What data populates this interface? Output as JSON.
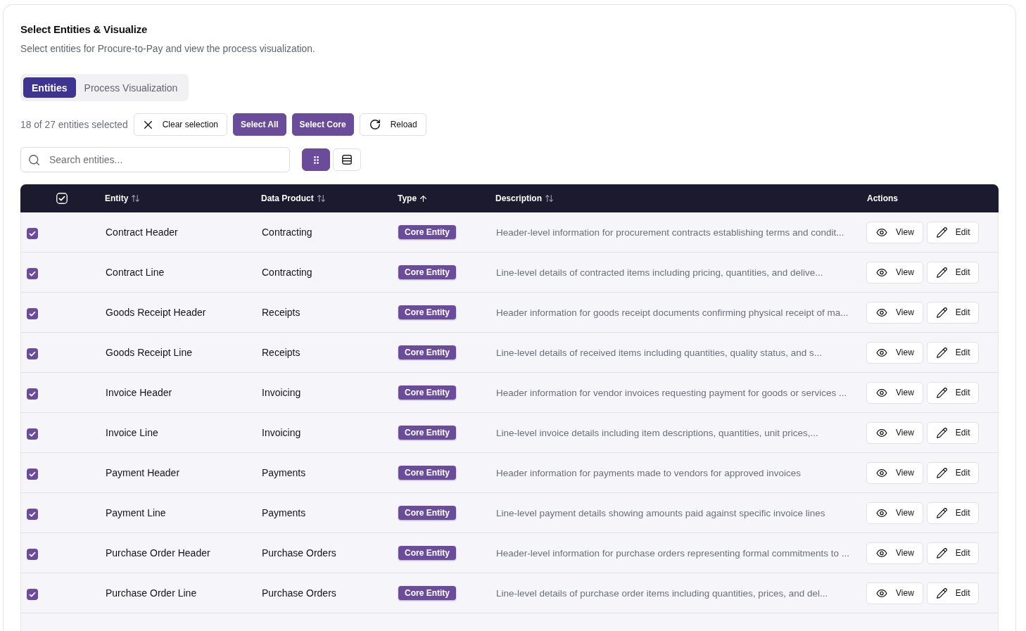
{
  "panel": {
    "title": "Select Entities & Visualize",
    "subtitle": "Select entities for Procure-to-Pay and view the process visualization."
  },
  "tabs": [
    {
      "label": "Entities",
      "selected": true
    },
    {
      "label": "Process Visualization",
      "selected": false
    }
  ],
  "toolbar": {
    "selection_summary": "18 of 27 entities selected",
    "buttons": [
      {
        "label": "Clear selection",
        "kind": "clear"
      },
      {
        "label": "Select All",
        "kind": "primary"
      },
      {
        "label": "Select Core",
        "kind": "primary"
      },
      {
        "label": "Reload",
        "kind": "reload"
      }
    ]
  },
  "search": {
    "placeholder": "Search entities..."
  },
  "view_modes": [
    {
      "kind": "grid",
      "selected": true
    },
    {
      "kind": "list",
      "selected": false
    }
  ],
  "table": {
    "select_all": {
      "checked": true
    },
    "columns": [
      {
        "label": "Entity",
        "sortable": true,
        "sorted": false
      },
      {
        "label": "Data Product",
        "sortable": true,
        "sorted": false
      },
      {
        "label": "Type",
        "sortable": true,
        "sorted": true
      },
      {
        "label": "Description",
        "sortable": true,
        "sorted": false
      },
      {
        "label": "Actions",
        "sortable": false
      }
    ],
    "rows": [
      {
        "selected": true,
        "entity": "Contract Header",
        "data_product": "Contracting",
        "type": "Core Entity",
        "description": "Header-level information for procurement contracts establishing terms and condit...",
        "actions": [
          {
            "label": "View",
            "kind": "view"
          },
          {
            "label": "Edit",
            "kind": "edit"
          }
        ]
      },
      {
        "selected": true,
        "entity": "Contract Line",
        "data_product": "Contracting",
        "type": "Core Entity",
        "description": "Line-level details of contracted items including pricing, quantities, and delive...",
        "actions": [
          {
            "label": "View",
            "kind": "view"
          },
          {
            "label": "Edit",
            "kind": "edit"
          }
        ]
      },
      {
        "selected": true,
        "entity": "Goods Receipt Header",
        "data_product": "Receipts",
        "type": "Core Entity",
        "description": "Header information for goods receipt documents confirming physical receipt of ma...",
        "actions": [
          {
            "label": "View",
            "kind": "view"
          },
          {
            "label": "Edit",
            "kind": "edit"
          }
        ]
      },
      {
        "selected": true,
        "entity": "Goods Receipt Line",
        "data_product": "Receipts",
        "type": "Core Entity",
        "description": "Line-level details of received items including quantities, quality status, and s...",
        "actions": [
          {
            "label": "View",
            "kind": "view"
          },
          {
            "label": "Edit",
            "kind": "edit"
          }
        ]
      },
      {
        "selected": true,
        "entity": "Invoice Header",
        "data_product": "Invoicing",
        "type": "Core Entity",
        "description": "Header information for vendor invoices requesting payment for goods or services ...",
        "actions": [
          {
            "label": "View",
            "kind": "view"
          },
          {
            "label": "Edit",
            "kind": "edit"
          }
        ]
      },
      {
        "selected": true,
        "entity": "Invoice Line",
        "data_product": "Invoicing",
        "type": "Core Entity",
        "description": "Line-level invoice details including item descriptions, quantities, unit prices,...",
        "actions": [
          {
            "label": "View",
            "kind": "view"
          },
          {
            "label": "Edit",
            "kind": "edit"
          }
        ]
      },
      {
        "selected": true,
        "entity": "Payment Header",
        "data_product": "Payments",
        "type": "Core Entity",
        "description": "Header information for payments made to vendors for approved invoices",
        "actions": [
          {
            "label": "View",
            "kind": "view"
          },
          {
            "label": "Edit",
            "kind": "edit"
          }
        ]
      },
      {
        "selected": true,
        "entity": "Payment Line",
        "data_product": "Payments",
        "type": "Core Entity",
        "description": "Line-level payment details showing amounts paid against specific invoice lines",
        "actions": [
          {
            "label": "View",
            "kind": "view"
          },
          {
            "label": "Edit",
            "kind": "edit"
          }
        ]
      },
      {
        "selected": true,
        "entity": "Purchase Order Header",
        "data_product": "Purchase Orders",
        "type": "Core Entity",
        "description": "Header-level information for purchase orders representing formal commitments to ...",
        "actions": [
          {
            "label": "View",
            "kind": "view"
          },
          {
            "label": "Edit",
            "kind": "edit"
          }
        ]
      },
      {
        "selected": true,
        "entity": "Purchase Order Line",
        "data_product": "Purchase Orders",
        "type": "Core Entity",
        "description": "Line-level details of purchase order items including quantities, prices, and del...",
        "actions": [
          {
            "label": "View",
            "kind": "view"
          },
          {
            "label": "Edit",
            "kind": "edit"
          }
        ]
      }
    ]
  }
}
